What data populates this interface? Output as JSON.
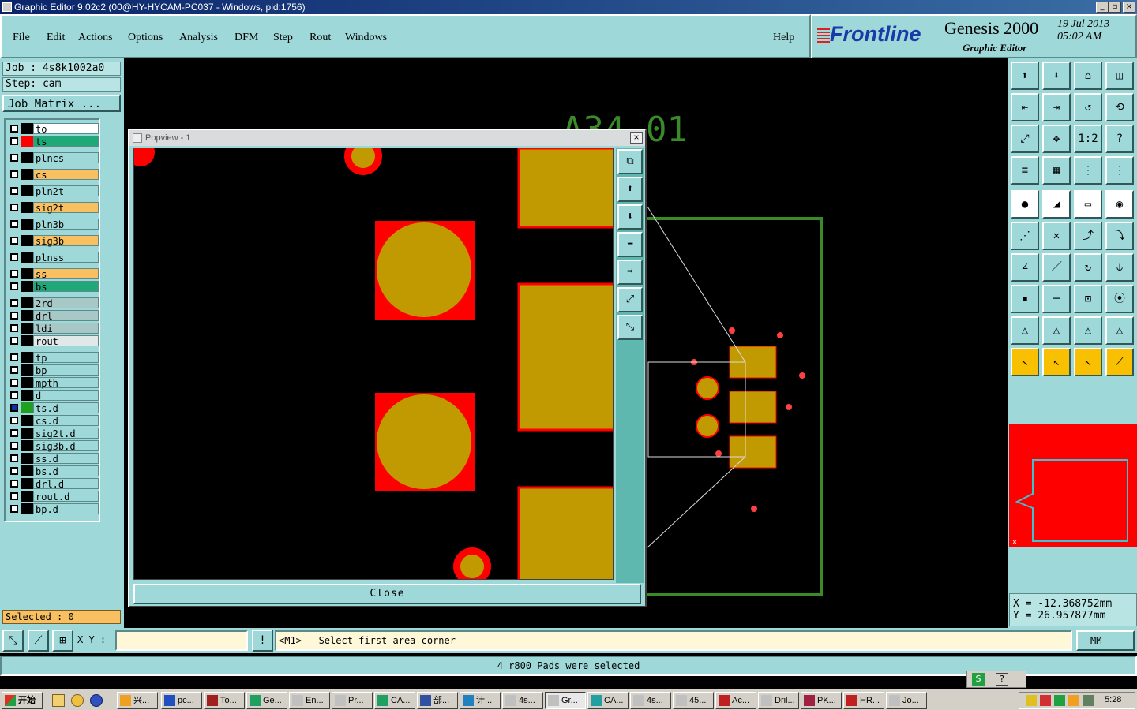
{
  "window": {
    "title": "Graphic Editor 9.02c2 (00@HY-HYCAM-PC037 - Windows, pid:1756)"
  },
  "menu": {
    "items": [
      "File",
      "Edit",
      "Actions",
      "Options",
      "Analysis",
      "DFM",
      "Step",
      "Rout",
      "Windows"
    ],
    "help": "Help"
  },
  "brand": {
    "logo": "Frontline",
    "product": "Genesis 2000",
    "subtitle": "Graphic Editor",
    "date": "19 Jul 2013",
    "time": "05:02 AM"
  },
  "job": {
    "job_label": "Job : 4s8k1002a0",
    "step_label": "Step: cam",
    "matrix_button": "Job Matrix ..."
  },
  "layers": [
    {
      "name": "to",
      "bg": "#ffffff",
      "swatch": "#000000",
      "dot": false
    },
    {
      "name": "ts",
      "bg": "#20a878",
      "swatch": "#ff0000",
      "dot": false
    },
    {
      "name": "plncs",
      "bg": "#9fd8d8",
      "swatch": "#000000",
      "dot": false
    },
    {
      "name": "cs",
      "bg": "#f8c060",
      "swatch": "#000000",
      "dot": false
    },
    {
      "name": "pln2t",
      "bg": "#9fd8d8",
      "swatch": "#000000",
      "dot": false
    },
    {
      "name": "sig2t",
      "bg": "#f8c060",
      "swatch": "#000000",
      "dot": false
    },
    {
      "name": "pln3b",
      "bg": "#9fd8d8",
      "swatch": "#000000",
      "dot": false
    },
    {
      "name": "sig3b",
      "bg": "#f8c060",
      "swatch": "#000000",
      "dot": false
    },
    {
      "name": "plnss",
      "bg": "#9fd8d8",
      "swatch": "#000000",
      "dot": false
    },
    {
      "name": "ss",
      "bg": "#f8c060",
      "swatch": "#000000",
      "dot": false
    },
    {
      "name": "bs",
      "bg": "#20a878",
      "swatch": "#000000",
      "dot": false
    },
    {
      "name": "2rd",
      "bg": "#a8c8c8",
      "swatch": "#000000",
      "dot": false
    },
    {
      "name": "drl",
      "bg": "#a8c8c8",
      "swatch": "#000000",
      "dot": false
    },
    {
      "name": "ldi",
      "bg": "#a8c8c8",
      "swatch": "#000000",
      "dot": false
    },
    {
      "name": "rout",
      "bg": "#e0e8e8",
      "swatch": "#000000",
      "dot": false
    },
    {
      "name": "tp",
      "bg": "#9fd8d8",
      "swatch": "#000000",
      "dot": false
    },
    {
      "name": "bp",
      "bg": "#9fd8d8",
      "swatch": "#000000",
      "dot": false
    },
    {
      "name": "mpth",
      "bg": "#9fd8d8",
      "swatch": "#000000",
      "dot": false
    },
    {
      "name": "d",
      "bg": "#9fd8d8",
      "swatch": "#000000",
      "dot": false
    },
    {
      "name": "ts.d",
      "bg": "#9fd8d8",
      "swatch": "#20a020",
      "dot": true
    },
    {
      "name": "cs.d",
      "bg": "#9fd8d8",
      "swatch": "#000000",
      "dot": false
    },
    {
      "name": "sig2t.d",
      "bg": "#9fd8d8",
      "swatch": "#000000",
      "dot": false
    },
    {
      "name": "sig3b.d",
      "bg": "#9fd8d8",
      "swatch": "#000000",
      "dot": false
    },
    {
      "name": "ss.d",
      "bg": "#9fd8d8",
      "swatch": "#000000",
      "dot": false
    },
    {
      "name": "bs.d",
      "bg": "#9fd8d8",
      "swatch": "#000000",
      "dot": false
    },
    {
      "name": "drl.d",
      "bg": "#9fd8d8",
      "swatch": "#000000",
      "dot": false
    },
    {
      "name": "rout.d",
      "bg": "#9fd8d8",
      "swatch": "#000000",
      "dot": false
    },
    {
      "name": "bp.d",
      "bg": "#9fd8d8",
      "swatch": "#000000",
      "dot": false
    }
  ],
  "selection": {
    "label": "Selected : 0"
  },
  "canvas": {
    "text": "A34 01"
  },
  "popview": {
    "title": "Popview - 1",
    "close_label": "Close"
  },
  "coords": {
    "x": "X = -12.368752mm",
    "y": "Y = 26.957877mm"
  },
  "command": {
    "xy_label": "X Y :",
    "xy_value": "",
    "prompt": "<M1> - Select first area corner",
    "units": "MM"
  },
  "status": {
    "message": "4 r800 Pads were selected"
  },
  "taskbar": {
    "start": "开始",
    "time": "5:28",
    "tasks": [
      "兴...",
      "pc...",
      "To...",
      "Ge...",
      "En...",
      "Pr...",
      "CA...",
      "部...",
      "计...",
      "4s...",
      "Gr...",
      "CA...",
      "4s...",
      "45...",
      "Ac...",
      "Dril...",
      "PK...",
      "HR...",
      "Jo..."
    ]
  },
  "colors": {
    "panel": "#9fd8d8",
    "pad_copper": "#c09a00",
    "pad_mask": "#ff0000",
    "board_outline": "#3a8a2a"
  }
}
